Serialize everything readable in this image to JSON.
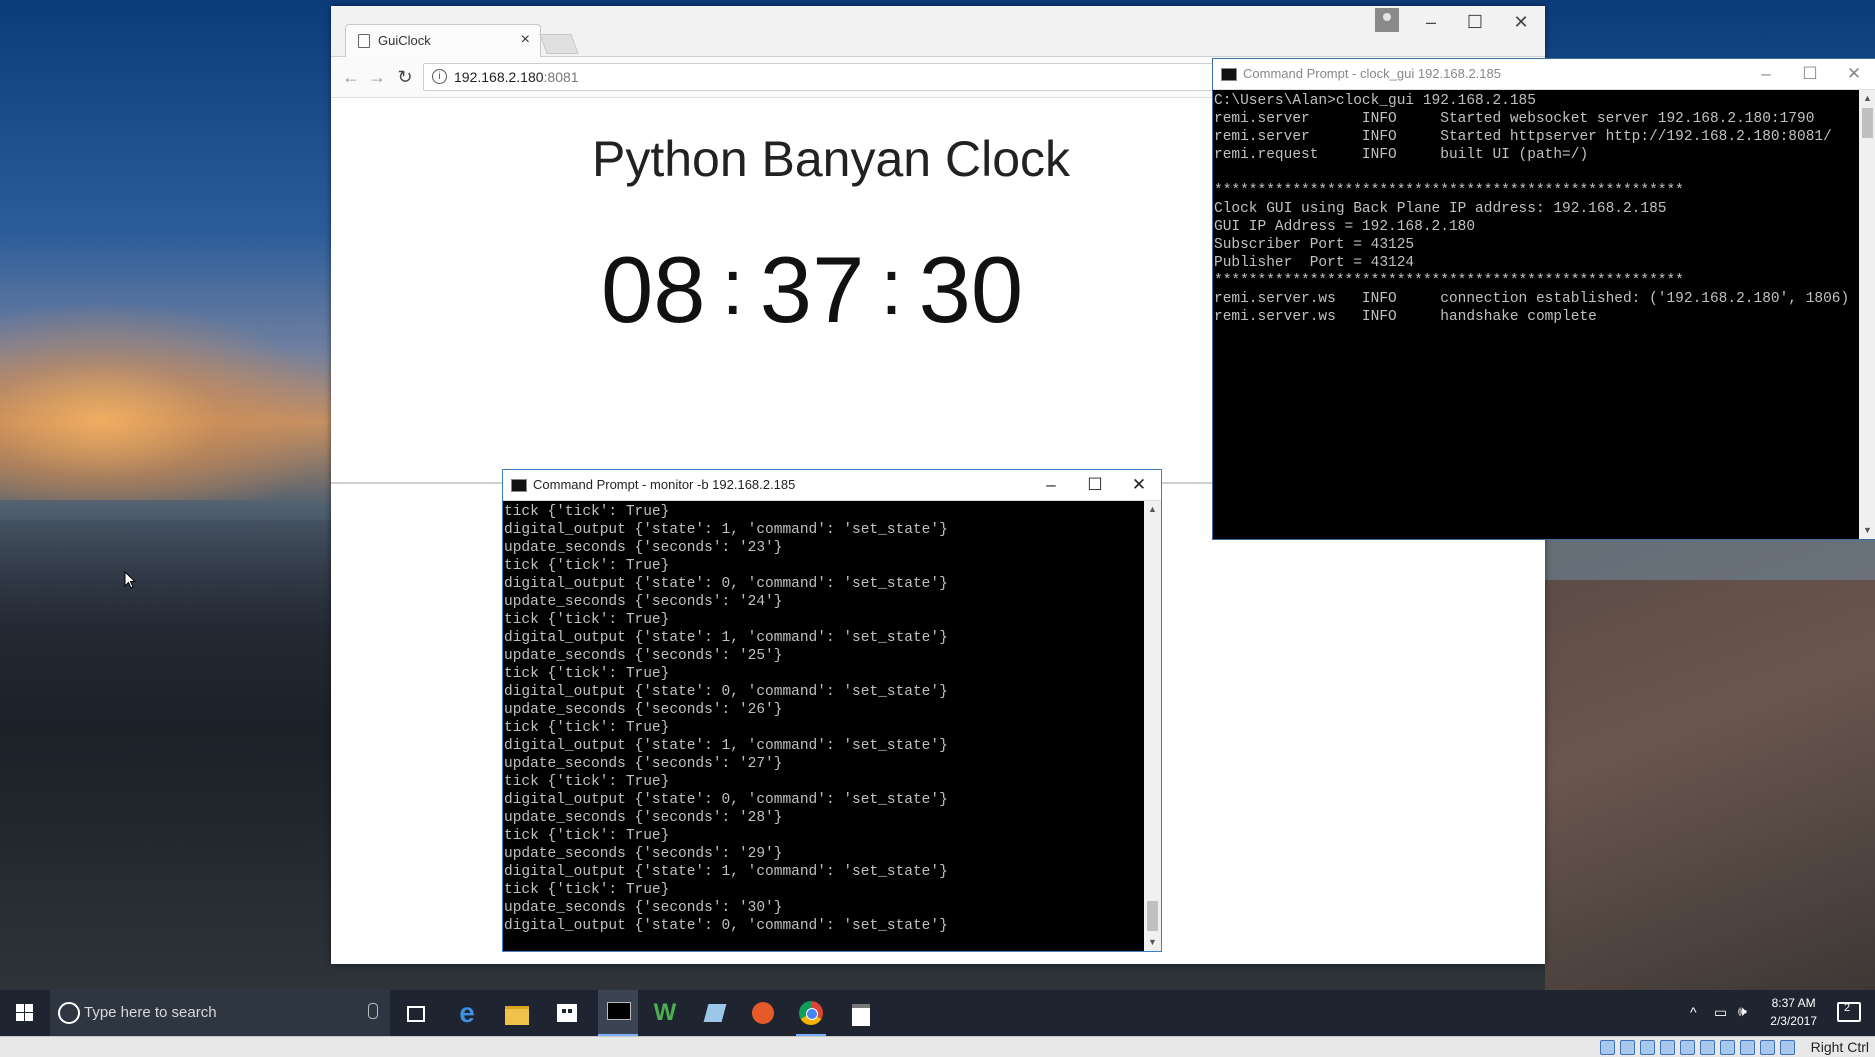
{
  "browser": {
    "tab_title": "GuiClock",
    "tab_close": "×",
    "url_host": "192.168.2.180",
    "url_port": ":8081",
    "page_title": "Python Banyan Clock",
    "clock": {
      "hours": "08",
      "minutes": "37",
      "seconds": "30",
      "separator": ":"
    }
  },
  "gui_console": {
    "title": "Command Prompt - clock_gui  192.168.2.185",
    "lines": [
      "C:\\Users\\Alan>clock_gui 192.168.2.185",
      "remi.server      INFO     Started websocket server 192.168.2.180:1790",
      "remi.server      INFO     Started httpserver http://192.168.2.180:8081/",
      "remi.request     INFO     built UI (path=/)",
      "",
      "******************************************************",
      "Clock GUI using Back Plane IP address: 192.168.2.185",
      "GUI IP Address = 192.168.2.180",
      "Subscriber Port = 43125",
      "Publisher  Port = 43124",
      "******************************************************",
      "remi.server.ws   INFO     connection established: ('192.168.2.180', 1806)",
      "remi.server.ws   INFO     handshake complete"
    ]
  },
  "monitor_console": {
    "title": "Command Prompt - monitor  -b 192.168.2.185",
    "lines": [
      "tick {'tick': True}",
      "digital_output {'state': 1, 'command': 'set_state'}",
      "update_seconds {'seconds': '23'}",
      "tick {'tick': True}",
      "digital_output {'state': 0, 'command': 'set_state'}",
      "update_seconds {'seconds': '24'}",
      "tick {'tick': True}",
      "digital_output {'state': 1, 'command': 'set_state'}",
      "update_seconds {'seconds': '25'}",
      "tick {'tick': True}",
      "digital_output {'state': 0, 'command': 'set_state'}",
      "update_seconds {'seconds': '26'}",
      "tick {'tick': True}",
      "digital_output {'state': 1, 'command': 'set_state'}",
      "update_seconds {'seconds': '27'}",
      "tick {'tick': True}",
      "digital_output {'state': 0, 'command': 'set_state'}",
      "update_seconds {'seconds': '28'}",
      "tick {'tick': True}",
      "update_seconds {'seconds': '29'}",
      "digital_output {'state': 1, 'command': 'set_state'}",
      "tick {'tick': True}",
      "update_seconds {'seconds': '30'}",
      "digital_output {'state': 0, 'command': 'set_state'}"
    ]
  },
  "window_controls": {
    "minimize": "–",
    "maximize": "☐",
    "close": "✕"
  },
  "taskbar": {
    "search_placeholder": "Type here to search",
    "time": "8:37 AM",
    "date": "2/3/2017",
    "notification_count": "2",
    "host_key": "Right Ctrl",
    "apps": [
      "task-view",
      "edge",
      "file-explorer",
      "store",
      "command-prompt",
      "app-w",
      "app-pen",
      "app-orange",
      "chrome",
      "notes"
    ]
  }
}
